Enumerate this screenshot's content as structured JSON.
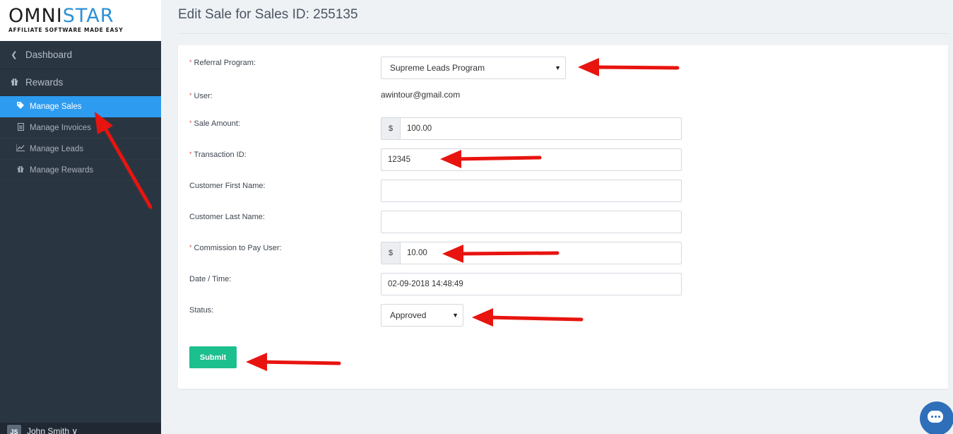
{
  "sidebar": {
    "logo": {
      "text_prefix": "OMNI",
      "text_star": "STAR",
      "tagline": "AFFILIATE SOFTWARE MADE EASY"
    },
    "dashboard_label": "Dashboard",
    "rewards_label": "Rewards",
    "items": [
      {
        "label": "Manage Sales",
        "icon": "tag-icon",
        "active": true
      },
      {
        "label": "Manage Invoices",
        "icon": "document-icon",
        "active": false
      },
      {
        "label": "Manage Leads",
        "icon": "line-chart-icon",
        "active": false
      },
      {
        "label": "Manage Rewards",
        "icon": "gift-icon",
        "active": false
      }
    ],
    "user": {
      "initials": "JS",
      "name": "John Smith ∨"
    }
  },
  "page": {
    "title": "Edit Sale for Sales ID: 255135"
  },
  "form": {
    "referral_program": {
      "label": "Referral Program:",
      "value": "Supreme Leads Program"
    },
    "user": {
      "label": "User:",
      "value": "awintour@gmail.com"
    },
    "sale_amount": {
      "label": "Sale Amount:",
      "currency": "$",
      "value": "100.00"
    },
    "transaction_id": {
      "label": "Transaction ID:",
      "value": "12345"
    },
    "first_name": {
      "label": "Customer First Name:",
      "value": ""
    },
    "last_name": {
      "label": "Customer Last Name:",
      "value": ""
    },
    "commission": {
      "label": "Commission to Pay User:",
      "currency": "$",
      "value": "10.00"
    },
    "datetime": {
      "label": "Date / Time:",
      "value": "02-09-2018 14:48:49"
    },
    "status": {
      "label": "Status:",
      "value": "Approved"
    },
    "required_mark": "*",
    "submit_label": "Submit"
  },
  "colors": {
    "sidebar_bg": "#2a3542",
    "active_item": "#2d9bf0",
    "submit_bg": "#1cbf8e",
    "annotation_arrow": "#e8140f"
  }
}
